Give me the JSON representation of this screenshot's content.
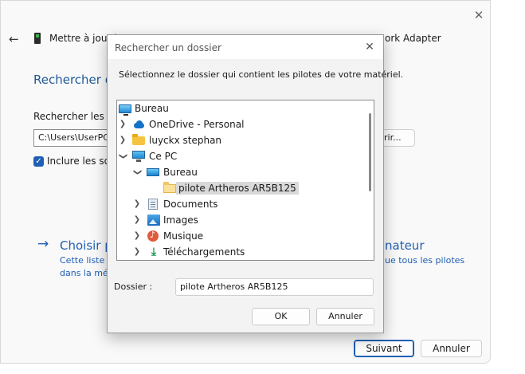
{
  "wizard": {
    "title_left": "Mettre à jour l",
    "title_right": "ork Adapter",
    "heading": "Rechercher d",
    "search_label": "Rechercher les pilo",
    "path_value": "C:\\Users\\UserPC",
    "browse_label": "rir...",
    "include_label": "Inclure les sous",
    "choose_left": "Choisir p",
    "choose_right": "nateur",
    "desc1_left": "Cette liste a",
    "desc2_left": "dans la mér",
    "desc1_right": "ue tous les pilotes",
    "next_label": "Suivant",
    "cancel_label": "Annuler",
    "colors": {
      "accent": "#1f5fb4",
      "heading": "#1f5a96"
    }
  },
  "dialog": {
    "title": "Rechercher un dossier",
    "instruction": "Sélectionnez le dossier qui contient les pilotes de votre matériel.",
    "tree": [
      {
        "label": "Bureau",
        "icon": "desktop-icon",
        "expander": ""
      },
      {
        "label": "OneDrive - Personal",
        "icon": "cloud-icon",
        "expander": "collapsed"
      },
      {
        "label": "luyckx stephan",
        "icon": "folder-icon",
        "expander": "collapsed"
      },
      {
        "label": "Ce PC",
        "icon": "pc-icon",
        "expander": "expanded"
      },
      {
        "label": "Bureau",
        "icon": "desktop-icon",
        "expander": "expanded"
      },
      {
        "label": "pilote Artheros AR5B125",
        "icon": "folder-open-icon",
        "expander": "",
        "selected": true
      },
      {
        "label": "Documents",
        "icon": "document-icon",
        "expander": "collapsed"
      },
      {
        "label": "Images",
        "icon": "image-icon",
        "expander": "collapsed"
      },
      {
        "label": "Musique",
        "icon": "music-icon",
        "expander": "collapsed"
      },
      {
        "label": "Téléchargements",
        "icon": "download-icon",
        "expander": "collapsed"
      }
    ],
    "folder_label": "Dossier :",
    "folder_value": "pilote Artheros AR5B125",
    "ok_label": "OK",
    "cancel_label": "Annuler"
  }
}
